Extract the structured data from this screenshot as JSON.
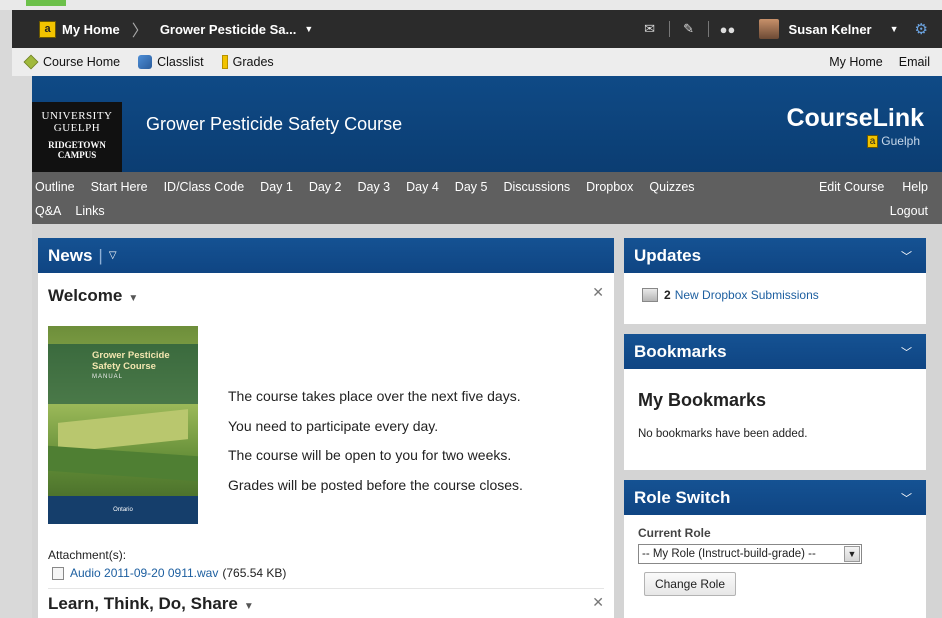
{
  "topbar": {
    "home_badge": "a",
    "home_label": "My Home",
    "course_crumb": "Grower Pesticide Sa...",
    "user_name": "Susan Kelner"
  },
  "subnav": {
    "course_home": "Course Home",
    "classlist": "Classlist",
    "grades": "Grades",
    "my_home": "My Home",
    "email": "Email"
  },
  "banner": {
    "logo_line1": "UNIVERSITY",
    "logo_line2": "GUELPH",
    "logo_line3": "RIDGETOWN",
    "logo_line4": "CAMPUS",
    "course_title": "Grower Pesticide Safety Course",
    "brand": "CourseLink",
    "brand_badge": "a",
    "brand_sub": "Guelph"
  },
  "coursenav": {
    "items": [
      "Outline",
      "Start Here",
      "ID/Class Code",
      "Day 1",
      "Day 2",
      "Day 3",
      "Day 4",
      "Day 5",
      "Discussions",
      "Dropbox",
      "Quizzes"
    ],
    "edit_course": "Edit Course",
    "help": "Help",
    "row2": [
      "Q&A",
      "Links"
    ],
    "logout": "Logout"
  },
  "news": {
    "title": "News",
    "post1_title": "Welcome",
    "cover_title": "Grower Pesticide Safety Course",
    "cover_sub": "MANUAL",
    "cover_footer": "Ontario",
    "lines": [
      "The course takes place over the next five days.",
      "You need to participate every day.",
      "The course will be open to you for two weeks.",
      "Grades will be posted before the course closes."
    ],
    "attachment_label": "Attachment(s):",
    "attachment_name": "Audio 2011-09-20 0911.wav",
    "attachment_size": "(765.54 KB)",
    "post2_title": "Learn, Think, Do, Share"
  },
  "updates": {
    "title": "Updates",
    "count": "2",
    "link": "New Dropbox Submissions"
  },
  "bookmarks": {
    "title": "Bookmarks",
    "heading": "My Bookmarks",
    "empty_text": "No bookmarks have been added."
  },
  "roleswitch": {
    "title": "Role Switch",
    "label": "Current Role",
    "selected": "-- My Role (Instruct-build-grade) --",
    "button": "Change Role"
  }
}
